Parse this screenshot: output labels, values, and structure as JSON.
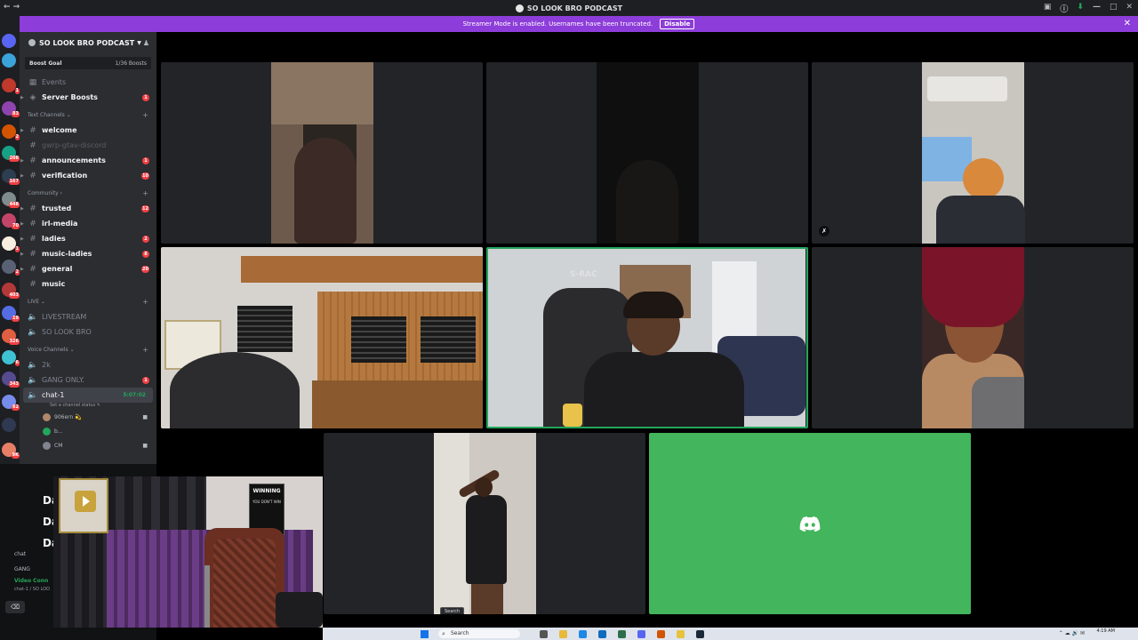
{
  "window": {
    "title": "SO LOOK BRO PODCAST"
  },
  "banner": {
    "text": "Streamer Mode is enabled. Usernames have been truncated.",
    "button_label": "Disable"
  },
  "server": {
    "name": "SO LOOK BRO PODCAST",
    "boost_goal_label": "Boost Goal",
    "boost_progress": "1/36 Boosts"
  },
  "top_items": [
    {
      "label": "Events",
      "badge": ""
    },
    {
      "label": "Server Boosts",
      "badge": "1"
    }
  ],
  "categories": {
    "text": "Text Channels",
    "community": "Community",
    "live": "LIVE",
    "voice": "Voice Channels"
  },
  "text_channels": [
    {
      "label": "welcome",
      "badge": ""
    },
    {
      "label": "gwrp-gtav-discord",
      "badge": ""
    },
    {
      "label": "announcements",
      "badge": "1"
    },
    {
      "label": "verification",
      "badge": "10"
    }
  ],
  "community_channels": [
    {
      "label": "trusted",
      "badge": "12"
    },
    {
      "label": "irl-media",
      "badge": ""
    },
    {
      "label": "ladies",
      "badge": "2"
    },
    {
      "label": "music-ladies",
      "badge": "8"
    },
    {
      "label": "general",
      "badge": "20"
    },
    {
      "label": "music",
      "badge": ""
    }
  ],
  "live_channels": [
    {
      "label": "LIVESTREAM"
    },
    {
      "label": "SO LOOK BRO"
    }
  ],
  "voice_channels": [
    {
      "label": "2k",
      "badge": ""
    },
    {
      "label": "GANG ONLY.",
      "badge": "1"
    }
  ],
  "active_voice": {
    "label": "chat-1",
    "timer": "5:07:02",
    "status_hint": "Set a channel status"
  },
  "voice_users": [
    {
      "name": "906ern 💫"
    },
    {
      "name": "b..."
    },
    {
      "name": "CM"
    }
  ],
  "lower_left": {
    "d1": "Da",
    "d2": "Da",
    "d3": "Da",
    "chat": "chat",
    "gang": "GANG",
    "vc_status": "Video Conn",
    "vc_sub": "chat-1 / SO LOO"
  },
  "webcam": {
    "poster_title": "WINNING",
    "poster_sub": "YOU DON'T WIN"
  },
  "tile_text": {
    "chair_brand": "S-RAC",
    "search_tip": "Search"
  },
  "taskbar": {
    "search_placeholder": "Search",
    "time": "4:19 AM"
  },
  "colors": {
    "banner": "#8d3dd9",
    "discord_green": "#43b55c",
    "speaking_border": "#23a55a",
    "badge_red": "#f23f43"
  }
}
